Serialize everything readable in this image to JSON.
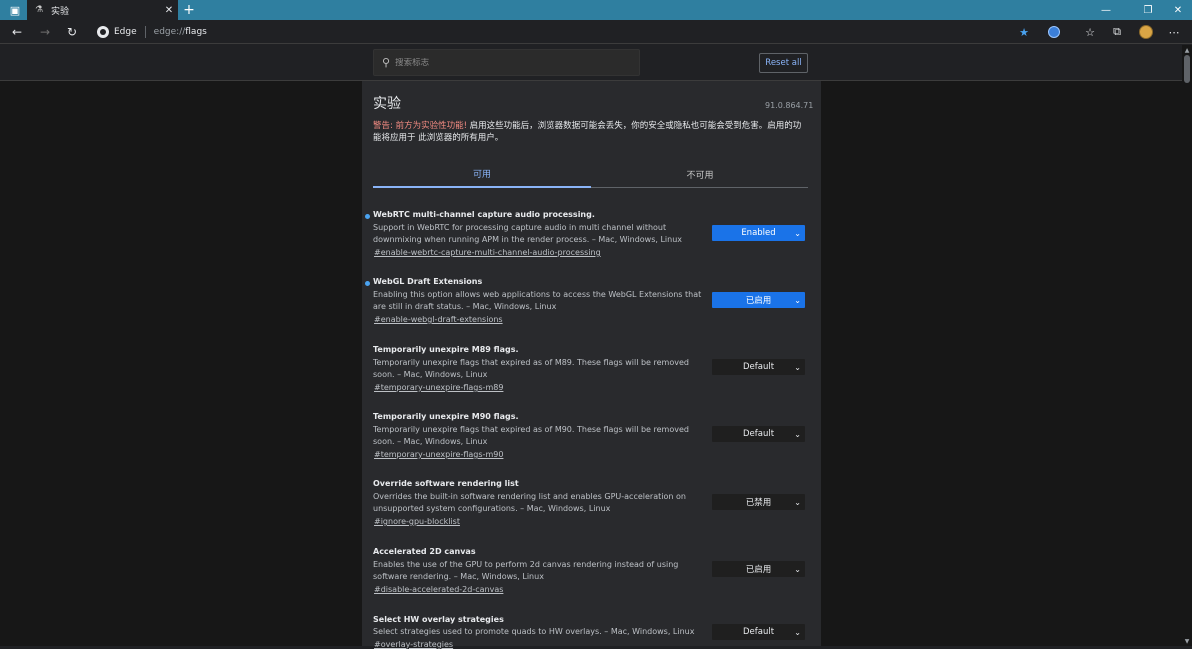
{
  "browser": {
    "tab_title": "实验",
    "site_label": "Edge",
    "url_scheme": "edge://",
    "url_host": "flags"
  },
  "search": {
    "placeholder": "搜索标志"
  },
  "reset_label": "Reset all",
  "page": {
    "title": "实验",
    "version": "91.0.864.71",
    "warning_prefix": "警告: 前方为实验性功能!",
    "warning_text": " 启用这些功能后，浏览器数据可能会丢失，你的安全或隐私也可能会受到危害。启用的功能将应用于 此浏览器的所有用户。"
  },
  "tabs": [
    {
      "label": "可用"
    },
    {
      "label": "不可用"
    }
  ],
  "experiments": [
    {
      "name": "WebRTC multi-channel capture audio processing.",
      "desc": "Support in WebRTC for processing capture audio in multi channel without downmixing when running APM in the render process. – Mac, Windows, Linux",
      "link": "#enable-webrtc-capture-multi-channel-audio-processing",
      "value": "Enabled",
      "modified": true
    },
    {
      "name": "WebGL Draft Extensions",
      "desc": "Enabling this option allows web applications to access the WebGL Extensions that are still in draft status. – Mac, Windows, Linux",
      "link": "#enable-webgl-draft-extensions",
      "value": "已启用",
      "modified": true
    },
    {
      "name": "Temporarily unexpire M89 flags.",
      "desc": "Temporarily unexpire flags that expired as of M89. These flags will be removed soon. – Mac, Windows, Linux",
      "link": "#temporary-unexpire-flags-m89",
      "value": "Default",
      "modified": false
    },
    {
      "name": "Temporarily unexpire M90 flags.",
      "desc": "Temporarily unexpire flags that expired as of M90. These flags will be removed soon. – Mac, Windows, Linux",
      "link": "#temporary-unexpire-flags-m90",
      "value": "Default",
      "modified": false
    },
    {
      "name": "Override software rendering list",
      "desc": "Overrides the built-in software rendering list and enables GPU-acceleration on unsupported system configurations. – Mac, Windows, Linux",
      "link": "#ignore-gpu-blocklist",
      "value": "已禁用",
      "modified": false
    },
    {
      "name": "Accelerated 2D canvas",
      "desc": "Enables the use of the GPU to perform 2d canvas rendering instead of using software rendering. – Mac, Windows, Linux",
      "link": "#disable-accelerated-2d-canvas",
      "value": "已启用",
      "modified": false
    },
    {
      "name": "Select HW overlay strategies",
      "desc": "Select strategies used to promote quads to HW overlays. – Mac, Windows, Linux",
      "link": "#overlay-strategies",
      "value": "Default",
      "modified": false
    }
  ],
  "icons": {
    "tab_actions": "tab-actions-icon",
    "tab_favicon": "flask-icon",
    "new_tab": "plus-icon",
    "minimize": "minimize-icon",
    "restore": "restore-icon",
    "close": "close-icon",
    "back": "back-arrow-icon",
    "forward": "forward-arrow-icon",
    "refresh": "refresh-icon",
    "favorite": "star-filled-icon",
    "extension": "extension-icon",
    "favorites": "favorites-icon",
    "collections": "collections-icon",
    "profile": "avatar",
    "more": "more-icon",
    "search": "search-icon"
  },
  "colors": {
    "titlebar": "#2f7fa0",
    "accent": "#8ab4f8",
    "enabled_select": "#1a73e8",
    "warning": "#f28b82"
  }
}
